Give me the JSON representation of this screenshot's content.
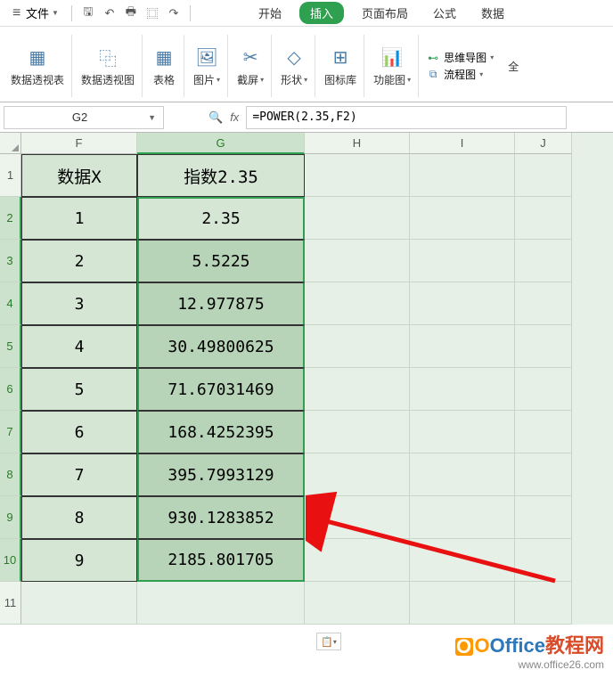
{
  "menu": {
    "file_label": "文件"
  },
  "tabs": {
    "start": "开始",
    "insert": "插入",
    "layout": "页面布局",
    "formula": "公式",
    "data": "数据"
  },
  "ribbon": {
    "pivot_table": "数据透视表",
    "pivot_chart": "数据透视图",
    "table": "表格",
    "picture": "图片",
    "screenshot": "截屏",
    "shape": "形状",
    "icon_lib": "图标库",
    "function_chart": "功能图",
    "mindmap": "思维导图",
    "flowchart": "流程图",
    "more": "全"
  },
  "name_box": "G2",
  "formula": "=POWER(2.35,F2)",
  "columns": [
    "F",
    "G",
    "H",
    "I",
    "J"
  ],
  "headers": {
    "F": "数据X",
    "G": "指数2.35"
  },
  "data_rows": [
    {
      "r": "2",
      "F": "1",
      "G": "2.35"
    },
    {
      "r": "3",
      "F": "2",
      "G": "5.5225"
    },
    {
      "r": "4",
      "F": "3",
      "G": "12.977875"
    },
    {
      "r": "5",
      "F": "4",
      "G": "30.49800625"
    },
    {
      "r": "6",
      "F": "5",
      "G": "71.67031469"
    },
    {
      "r": "7",
      "F": "6",
      "G": "168.4252395"
    },
    {
      "r": "8",
      "F": "7",
      "G": "395.7993129"
    },
    {
      "r": "9",
      "F": "8",
      "G": "930.1283852"
    },
    {
      "r": "10",
      "F": "9",
      "G": "2185.801705"
    }
  ],
  "row11": "11",
  "watermark": {
    "brand": "Office",
    "suffix": "教程网",
    "url": "www.office26.com"
  }
}
